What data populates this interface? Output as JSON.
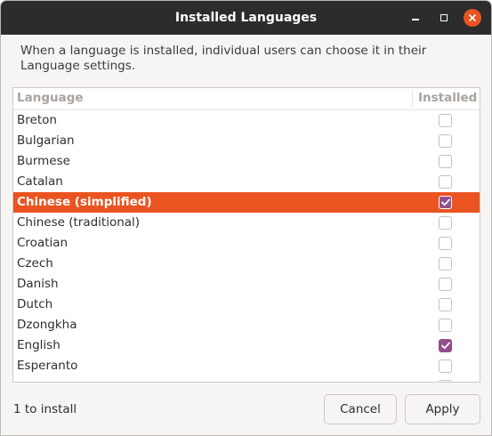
{
  "window": {
    "title": "Installed Languages"
  },
  "description": "When a language is installed, individual users can choose it in their Language settings.",
  "table": {
    "columns": [
      "Language",
      "Installed"
    ],
    "rows": [
      {
        "name": "Breton",
        "installed": false,
        "selected": false
      },
      {
        "name": "Bulgarian",
        "installed": false,
        "selected": false
      },
      {
        "name": "Burmese",
        "installed": false,
        "selected": false
      },
      {
        "name": "Catalan",
        "installed": false,
        "selected": false
      },
      {
        "name": "Chinese (simplified)",
        "installed": true,
        "selected": true
      },
      {
        "name": "Chinese (traditional)",
        "installed": false,
        "selected": false
      },
      {
        "name": "Croatian",
        "installed": false,
        "selected": false
      },
      {
        "name": "Czech",
        "installed": false,
        "selected": false
      },
      {
        "name": "Danish",
        "installed": false,
        "selected": false
      },
      {
        "name": "Dutch",
        "installed": false,
        "selected": false
      },
      {
        "name": "Dzongkha",
        "installed": false,
        "selected": false
      },
      {
        "name": "English",
        "installed": true,
        "selected": false
      },
      {
        "name": "Esperanto",
        "installed": false,
        "selected": false
      },
      {
        "name": "",
        "installed": false,
        "selected": false
      }
    ]
  },
  "footer": {
    "status": "1 to install",
    "cancel_label": "Cancel",
    "apply_label": "Apply"
  },
  "colors": {
    "accent": "#e95420",
    "check": "#924d8b",
    "titlebar": "#2c2c2c"
  },
  "icons": [
    "minimize-icon",
    "maximize-icon",
    "close-icon",
    "checkmark-icon"
  ]
}
